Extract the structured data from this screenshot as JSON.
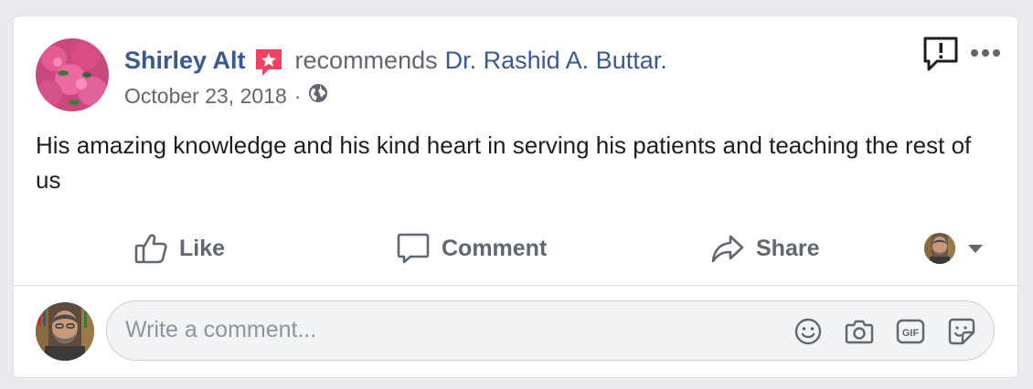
{
  "post": {
    "author": "Shirley Alt",
    "verb": "recommends",
    "target": "Dr. Rashid A. Buttar.",
    "date": "October 23, 2018",
    "separator": "·",
    "privacy_icon": "globe-icon",
    "text": "His amazing knowledge and his kind heart in serving his patients and teaching the rest of us"
  },
  "actions": {
    "like_label": "Like",
    "comment_label": "Comment",
    "share_label": "Share"
  },
  "comment_composer": {
    "placeholder": "Write a comment...",
    "icons": [
      "emoji-icon",
      "camera-icon",
      "gif-icon",
      "sticker-icon"
    ]
  },
  "colors": {
    "link_blue": "#385898",
    "secondary_text": "#606770",
    "recommend_badge": "#f3425f",
    "page_background": "#e9ebee"
  }
}
